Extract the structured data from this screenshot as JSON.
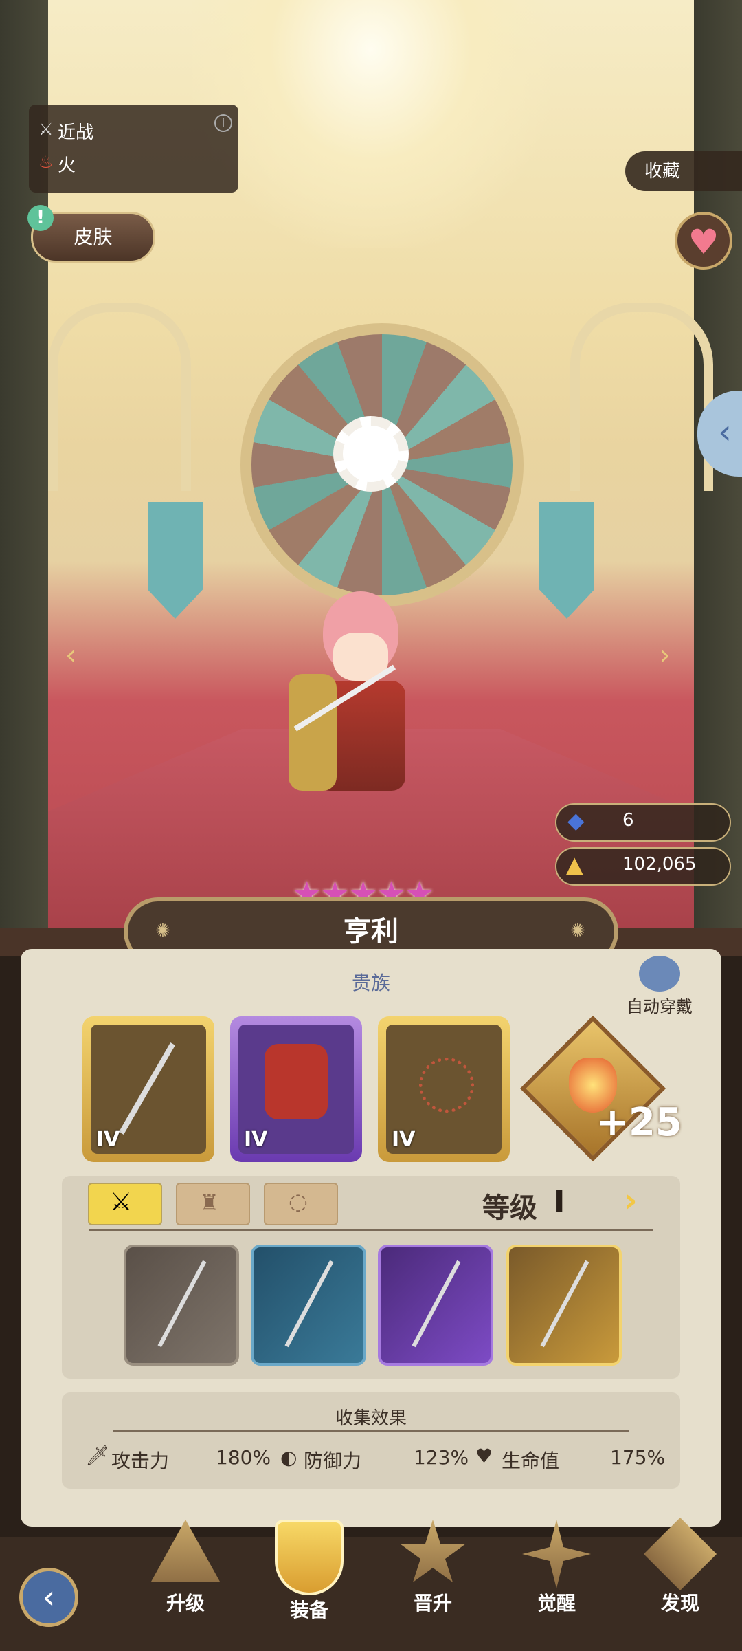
{
  "hero": {
    "name": "亨利",
    "class": "贵族",
    "type_label": "近战",
    "element_label": "火",
    "skin_button": "皮肤",
    "collect_button": "收藏",
    "stars": 5
  },
  "currency": [
    {
      "icon": "blue-gem-icon",
      "value": "6"
    },
    {
      "icon": "gold-pile-icon",
      "value": "102,065"
    }
  ],
  "auto_equip_label": "自动穿戴",
  "equipment": [
    {
      "icon": "spear-icon",
      "tier": "IV",
      "rarity": "gold"
    },
    {
      "icon": "armor-icon",
      "tier": "IV",
      "rarity": "purple"
    },
    {
      "icon": "necklace-icon",
      "tier": "IV",
      "rarity": "gold"
    },
    {
      "icon": "fire-emblem-icon",
      "bonus": "+25",
      "rarity": "gold"
    }
  ],
  "equip_tabs": [
    "weapon",
    "armor",
    "accessory"
  ],
  "level_label": "等级",
  "level_value": "I",
  "sword_variants": [
    "gray",
    "blue",
    "purple",
    "gold"
  ],
  "collection": {
    "title": "收集效果",
    "stats": [
      {
        "icon": "sword-icon",
        "label": "攻击力",
        "value": "180%"
      },
      {
        "icon": "shield-icon",
        "label": "防御力",
        "value": "123%"
      },
      {
        "icon": "heart-icon",
        "label": "生命值",
        "value": "175%"
      }
    ]
  },
  "nav": [
    {
      "label": "升级",
      "icon": "upgrade-icon"
    },
    {
      "label": "装备",
      "icon": "equip-icon",
      "active": true
    },
    {
      "label": "晋升",
      "icon": "promote-icon"
    },
    {
      "label": "觉醒",
      "icon": "awaken-icon"
    },
    {
      "label": "发现",
      "icon": "discover-icon"
    }
  ],
  "colors": {
    "gold": "#e8b94a",
    "purple": "#7d4bc5",
    "blue": "#3a7a98",
    "accent": "#f2c746"
  }
}
